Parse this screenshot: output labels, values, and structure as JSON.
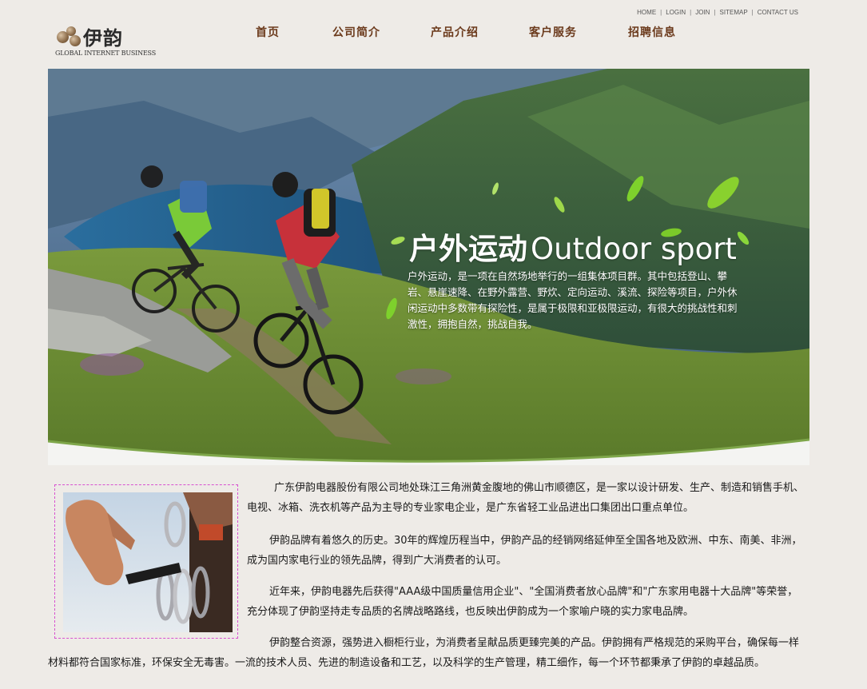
{
  "header": {
    "logo_text": "伊韵",
    "logo_subtitle": "GLOBAL INTERNET BUSINESS",
    "top_links": [
      "HOME",
      "LOGIN",
      "JOIN",
      "SITEMAP",
      "CONTACT US"
    ],
    "nav": [
      "首页",
      "公司简介",
      "产品介绍",
      "客户服务",
      "招聘信息"
    ]
  },
  "banner": {
    "title_cn": "户外运动",
    "title_en": "Outdoor sport",
    "description": "户外运动，是一项在自然场地举行的一组集体项目群。其中包括登山、攀岩、悬崖速降、在野外露营、野炊、定向运动、溪流、探险等项目，户外休闲运动中多数带有探险性，是属于极限和亚极限运动，有很大的挑战性和刺激性，拥抱自然，挑战自我。"
  },
  "content": {
    "paragraphs": [
      "广东伊韵电器股份有限公司地处珠江三角洲黄金腹地的佛山市顺德区，是一家以设计研发、生产、制造和销售手机、电视、冰箱、洗衣机等产品为主导的专业家电企业，是广东省轻工业品进出口集团出口重点单位。",
      "伊韵品牌有着悠久的历史。30年的辉煌历程当中，伊韵产品的经销网络延伸至全国各地及欧洲、中东、南美、非洲，成为国内家电行业的领先品牌，得到广大消费者的认可。",
      "近年来，伊韵电器先后获得\"AAA级中国质量信用企业\"、\"全国消费者放心品牌\"和\"广东家用电器十大品牌\"等荣誉，充分体现了伊韵坚持走专品质的名牌战略路线，也反映出伊韵成为一个家喻户晓的实力家电品牌。",
      "伊韵整合资源，强势进入橱柜行业，为消费者呈献品质更臻完美的产品。伊韵拥有严格规范的采购平台，确保每一样材料都符合国家标准，环保安全无毒害。一流的技术人员、先进的制造设备和工艺，以及科学的生产管理，精工细作，每一个环节都秉承了伊韵的卓越品质。"
    ]
  },
  "colors": {
    "page_background": "#eeebe7",
    "nav_text": "#6b3a1c",
    "photo_border": "#d850d0",
    "banner_curve": "#7ea64a"
  }
}
